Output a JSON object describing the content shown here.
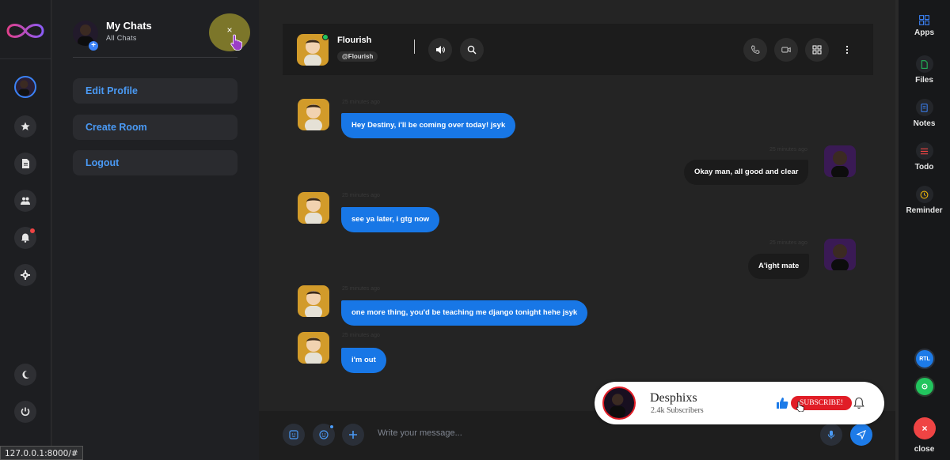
{
  "sidebar": {
    "logo": "infinity-logo-icon",
    "items": [
      {
        "name": "star-icon"
      },
      {
        "name": "document-icon"
      },
      {
        "name": "group-icon"
      },
      {
        "name": "bell-icon"
      },
      {
        "name": "gear-icon"
      }
    ],
    "bottom": [
      {
        "name": "moon-icon"
      },
      {
        "name": "power-icon"
      }
    ]
  },
  "panel": {
    "title": "My Chats",
    "subtitle": "All Chats",
    "close_label": "×",
    "menu": [
      {
        "label": "Edit Profile"
      },
      {
        "label": "Create Room"
      },
      {
        "label": "Logout"
      }
    ]
  },
  "chat": {
    "contact_name": "Flourish",
    "contact_handle": "@Flourish",
    "messages": [
      {
        "from": "them",
        "text": "Hey Destiny, i'll be coming over today! jsyk",
        "time": "25 minutes ago"
      },
      {
        "from": "me",
        "text": "Okay man, all good and clear",
        "time": "25 minutes ago"
      },
      {
        "from": "them",
        "text": "see ya later, i gtg now",
        "time": "25 minutes ago"
      },
      {
        "from": "me",
        "text": "A'ight mate",
        "time": "25 minutes ago"
      },
      {
        "from": "them",
        "text": "one more thing, you'd be teaching me django tonight hehe jsyk",
        "time": "25 minutes ago"
      },
      {
        "from": "them",
        "text": "i'm out",
        "time": "25 minutes ago"
      }
    ],
    "composer_placeholder": "Write your message..."
  },
  "right_rail": {
    "items": [
      {
        "label": "Apps",
        "icon": "grid-icon",
        "color": "#3b82f6"
      },
      {
        "label": "Files",
        "icon": "file-icon",
        "color": "#22c55e"
      },
      {
        "label": "Notes",
        "icon": "notes-icon",
        "color": "#3b82f6"
      },
      {
        "label": "Todo",
        "icon": "list-icon",
        "color": "#ef4444"
      },
      {
        "label": "Reminder",
        "icon": "clock-icon",
        "color": "#eab308"
      }
    ],
    "rtl_label": "RTL",
    "close_label": "close"
  },
  "subscribe_card": {
    "channel": "Desphixs",
    "subscribers": "2.4k Subscribers",
    "button": "SUBSCRIBE!"
  },
  "status_url": "127.0.0.1:8000/#",
  "colors": {
    "accent": "#1877e6",
    "link": "#4a9af5",
    "subscribe": "#e11d26"
  }
}
